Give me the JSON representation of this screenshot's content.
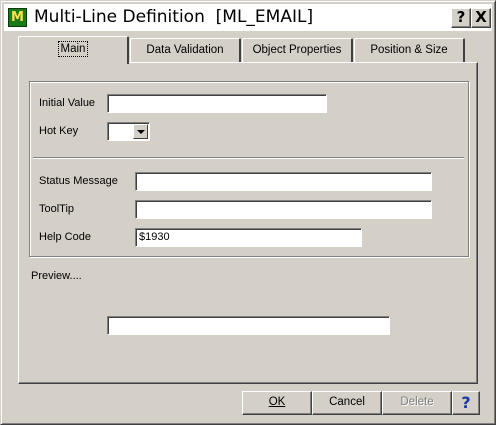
{
  "window": {
    "title": "Multi-Line Definition  [ML_EMAIL]",
    "icon": "M",
    "help_button": "?",
    "close_button": "X"
  },
  "tabs": [
    {
      "label": "Main",
      "active": true
    },
    {
      "label": "Data Validation",
      "active": false
    },
    {
      "label": "Object Properties",
      "active": false
    },
    {
      "label": "Position & Size",
      "active": false
    }
  ],
  "main": {
    "initial_value_label": "Initial Value",
    "initial_value": "",
    "hot_key_label": "Hot Key",
    "hot_key_value": "",
    "status_message_label": "Status Message",
    "status_message": "",
    "tooltip_label": "ToolTip",
    "tooltip": "",
    "help_code_label": "Help Code",
    "help_code": "$1930",
    "preview_label": "Preview....",
    "preview_value": ""
  },
  "buttons": {
    "ok": "OK",
    "cancel": "Cancel",
    "delete": "Delete",
    "help": "?"
  }
}
